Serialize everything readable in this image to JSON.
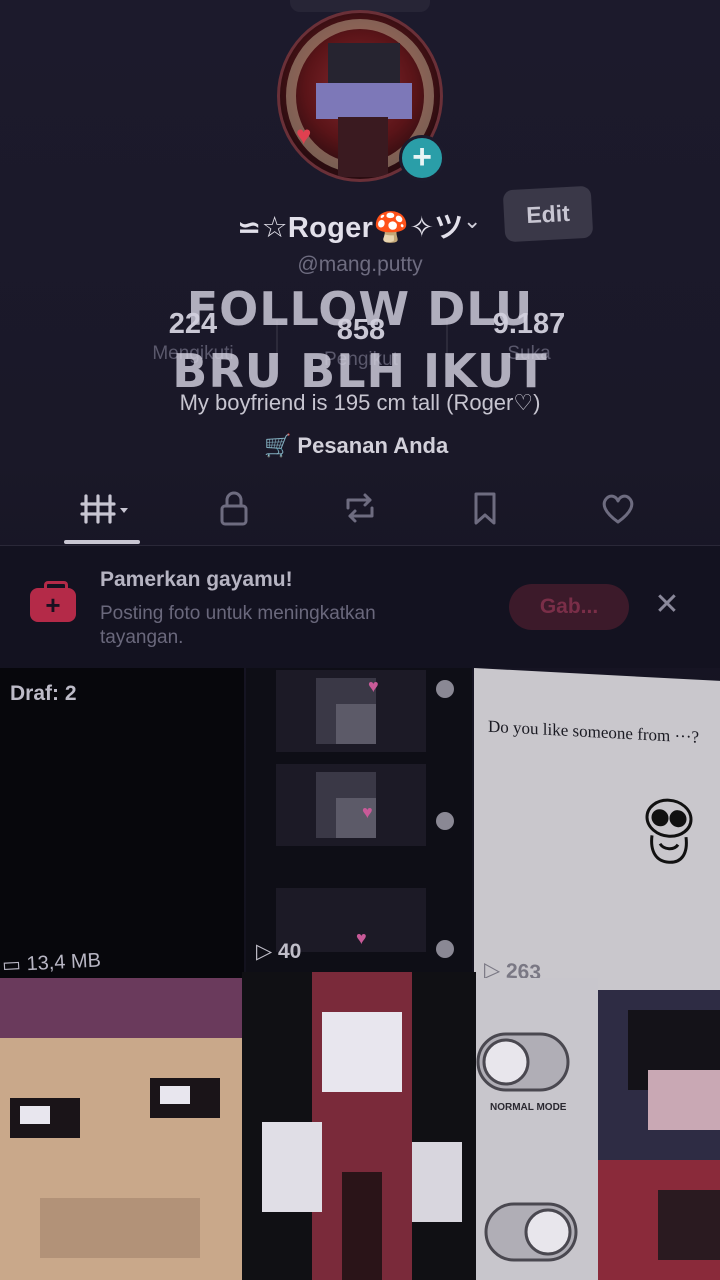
{
  "profile": {
    "display_name": "⋍☆Roger🍄✧ツ",
    "username": "@mang.putty",
    "edit_label": "Edit",
    "bio": "My boyfriend is 195 cm tall (Roger♡)",
    "orders_label": "Pesanan Anda"
  },
  "stats": [
    {
      "value": "224",
      "label": "Mengikuti"
    },
    {
      "value": "858",
      "label": "Pengikut"
    },
    {
      "value": "9.187",
      "label": "Suka"
    }
  ],
  "overlay_caption": {
    "line1": "FOLLOW DLU",
    "line2": "BRU BLH IKUT"
  },
  "tabs": [
    {
      "icon": "grid-icon",
      "active": true
    },
    {
      "icon": "lock-icon"
    },
    {
      "icon": "repost-icon"
    },
    {
      "icon": "bookmark-icon"
    },
    {
      "icon": "heart-icon"
    }
  ],
  "promo": {
    "title": "Pamerkan gayamu!",
    "subtitle": "Posting foto untuk meningkatkan tayangan.",
    "button_label": "Gab...",
    "close_icon": "close-icon"
  },
  "grid": {
    "draft_label": "Draf: 2",
    "draft_size": "13,4 MB",
    "video_2_views": "40",
    "video_3_views": "263",
    "video_3_text": "Do you like someone from ···?",
    "video_6_text": "NORMAL MODE"
  },
  "colors": {
    "accent_pink": "#d8385c",
    "avatar_badge": "#2a9ea8",
    "background": "#1a1828"
  }
}
